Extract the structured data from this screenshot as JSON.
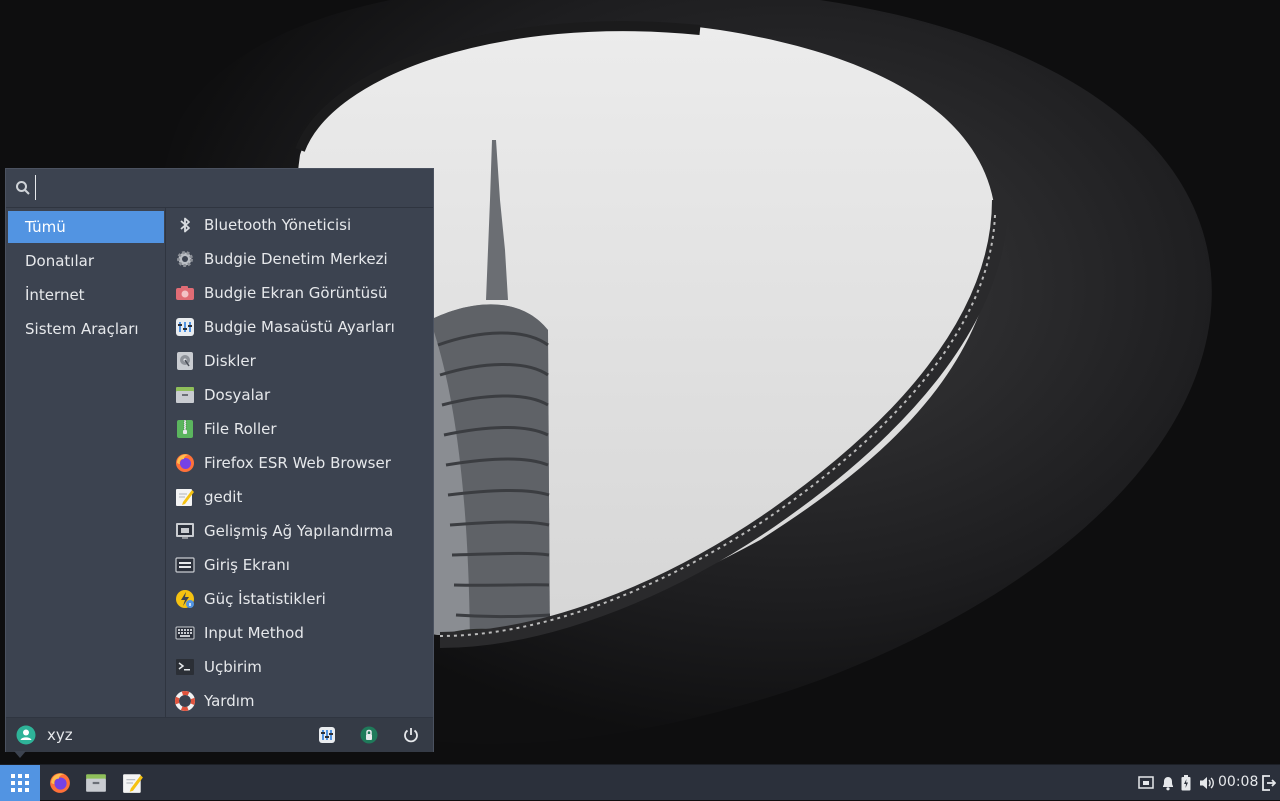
{
  "search": {
    "placeholder": "",
    "value": ""
  },
  "categories": [
    {
      "label": "Tümü",
      "active": true
    },
    {
      "label": "Donatılar",
      "active": false
    },
    {
      "label": "İnternet",
      "active": false
    },
    {
      "label": "Sistem Araçları",
      "active": false
    }
  ],
  "apps": [
    {
      "label": "Bluetooth Yöneticisi",
      "icon": "bluetooth-icon"
    },
    {
      "label": "Budgie Denetim Merkezi",
      "icon": "gear-icon"
    },
    {
      "label": "Budgie Ekran Görüntüsü",
      "icon": "camera-icon"
    },
    {
      "label": "Budgie Masaüstü Ayarları",
      "icon": "desktop-settings-icon"
    },
    {
      "label": "Diskler",
      "icon": "disks-icon"
    },
    {
      "label": "Dosyalar",
      "icon": "file-manager-icon"
    },
    {
      "label": "File Roller",
      "icon": "archive-icon"
    },
    {
      "label": "Firefox ESR Web Browser",
      "icon": "firefox-icon"
    },
    {
      "label": "gedit",
      "icon": "text-editor-icon"
    },
    {
      "label": "Gelişmiş Ağ Yapılandırma",
      "icon": "network-icon"
    },
    {
      "label": "Giriş Ekranı",
      "icon": "login-screen-icon"
    },
    {
      "label": "Güç İstatistikleri",
      "icon": "power-statistics-icon"
    },
    {
      "label": "Input Method",
      "icon": "keyboard-icon"
    },
    {
      "label": "Uçbirim",
      "icon": "terminal-icon"
    },
    {
      "label": "Yardım",
      "icon": "help-lifebuoy-icon"
    }
  ],
  "footer": {
    "user_name": "xyz",
    "buttons": [
      "desktop-settings-icon",
      "lock-icon",
      "power-icon"
    ]
  },
  "panel": {
    "clock": "00:08",
    "tasks": [
      "firefox-icon",
      "file-manager-icon",
      "text-editor-icon"
    ],
    "tray": [
      "network-wired-icon",
      "bell-icon",
      "battery-icon",
      "volume-icon",
      "logout-icon"
    ]
  },
  "colors": {
    "accent": "#5294e2",
    "menu_bg": "#3c4350",
    "panel_bg": "#2b303b"
  }
}
